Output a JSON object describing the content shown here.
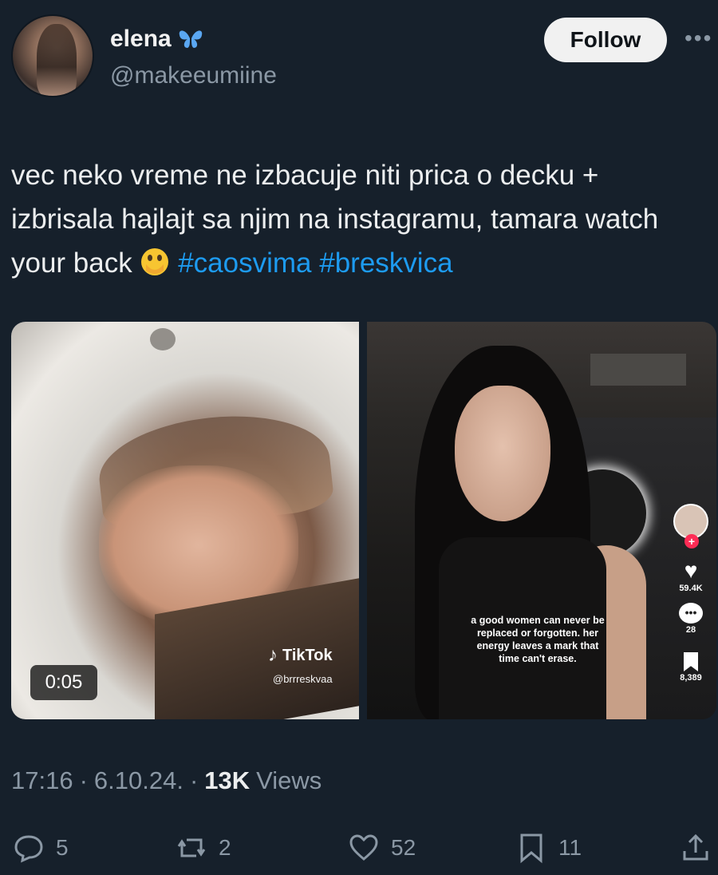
{
  "header": {
    "display_name": "elena",
    "handle": "@makeeumiine",
    "follow_label": "Follow",
    "more_label": "•••"
  },
  "tweet": {
    "text_main": "vec neko vreme ne izbacuje niti prica o decku + izbrisala hajlajt sa njim na instagramu, tamara watch your back",
    "hashtags": [
      "#caosvima",
      "#breskvica"
    ]
  },
  "media": {
    "left_video": {
      "duration": "0:05",
      "watermark_brand": "TikTok",
      "watermark_user": "@brrreskvaa"
    },
    "right_video": {
      "caption": "a good women can never be replaced or forgotten. her energy leaves a mark that time can't erase.",
      "likes": "59.4K",
      "comments": "28",
      "saves": "8,389"
    }
  },
  "meta": {
    "time": "17:16",
    "date": "6.10.24.",
    "views_count": "13K",
    "views_label": "Views"
  },
  "actions": {
    "replies": "5",
    "reposts": "2",
    "likes": "52",
    "bookmarks": "11"
  },
  "colors": {
    "background": "#16202b",
    "hashtag": "#1d9bf0",
    "muted": "#8b98a5",
    "butterfly": "#5aa7f2"
  }
}
